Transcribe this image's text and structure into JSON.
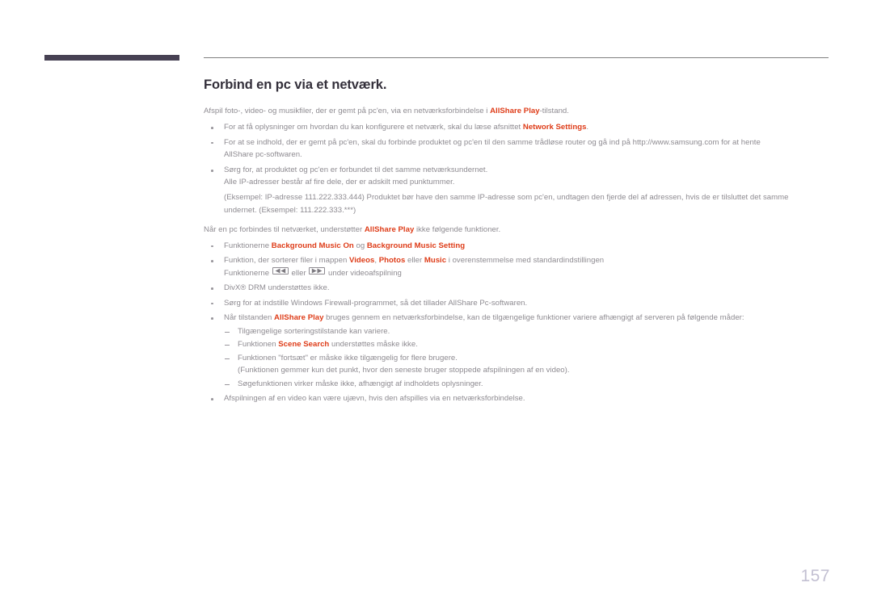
{
  "page": {
    "number": "157",
    "accent_color": "#de3c18",
    "heading_color": "#332f3a",
    "body_color": "#8e8b91",
    "rule_color": "#808080",
    "bar_color": "#474153",
    "page_number_color": "#c3c0d2"
  },
  "header": {
    "title": "Forbind en pc via et netværk."
  },
  "content": {
    "lead": {
      "before": "Afspil foto-, video- og musikfiler, der er gemt på pc'en, via en netværksforbindelse i ",
      "accent": "AllShare Play",
      "after": "-tilstand."
    },
    "bullets_1": [
      {
        "before": "For at få oplysninger om hvordan du kan konfigurere et netværk, skal du læse afsnittet ",
        "accent": "Network Settings",
        "after": "."
      },
      {
        "text": "For at se indhold, der er gemt på pc'en, skal du forbinde produktet og pc'en til den samme trådløse router og gå ind på http://www.samsung.com for at hente",
        "line2": "AllShare pc-softwaren."
      },
      {
        "text": "Sørg for, at produktet og pc'en er forbundet til det samme netværksundernet.",
        "line2": "Alle IP-adresser består af fire dele, der er adskilt med punktummer.",
        "line3": "(Eksempel: IP-adresse 111.222.333.444) Produktet bør have den samme IP-adresse som pc'en, undtagen den fjerde del af adressen, hvis de er tilsluttet det samme",
        "line4": "undernet. (Eksempel: 111.222.333.***)"
      }
    ],
    "intro_2": {
      "before": "Når en pc forbindes til netværket, understøtter ",
      "accent": "AllShare Play",
      "after": " ikke følgende funktioner."
    },
    "bullets_2": [
      {
        "before": "Funktionerne ",
        "accent1": "Background Music On",
        "middle": " og ",
        "accent2": "Background Music Setting",
        "after": ""
      },
      {
        "before": "Funktion, der sorterer filer i mappen ",
        "accent1": "Videos",
        "sep1": ", ",
        "accent2": "Photos",
        "sep2": " eller ",
        "accent3": "Music",
        "after": " i overenstemmelse med standardindstillingen",
        "line2_before": "Funktionerne ",
        "line2_icon1": "rewind-icon",
        "line2_middle": " eller ",
        "line2_icon2": "fast-forward-icon",
        "line2_after": " under videoafspilning"
      },
      {
        "text": "DivX® DRM understøttes ikke."
      },
      {
        "text": "Sørg for at indstille Windows Firewall-programmet, så det tillader AllShare Pc-softwaren."
      },
      {
        "before": "Når tilstanden ",
        "accent": "AllShare Play",
        "after": " bruges gennem en netværksforbindelse, kan de tilgængelige funktioner variere afhængigt af serveren på følgende måder:",
        "sub_items": [
          {
            "text": "Tilgængelige sorteringstilstande kan variere."
          },
          {
            "before": "Funktionen ",
            "accent": "Scene Search",
            "after": " understøttes måske ikke."
          },
          {
            "text": "Funktionen \"fortsæt\" er måske ikke tilgængelig for flere brugere.",
            "line2": "(Funktionen gemmer kun det punkt, hvor den seneste bruger stoppede afspilningen af en video)."
          },
          {
            "text": "Søgefunktionen virker måske ikke, afhængigt af indholdets oplysninger."
          }
        ]
      },
      {
        "text": "Afspilningen af en video kan være ujævn, hvis den afspilles via en netværksforbindelse."
      }
    ]
  }
}
